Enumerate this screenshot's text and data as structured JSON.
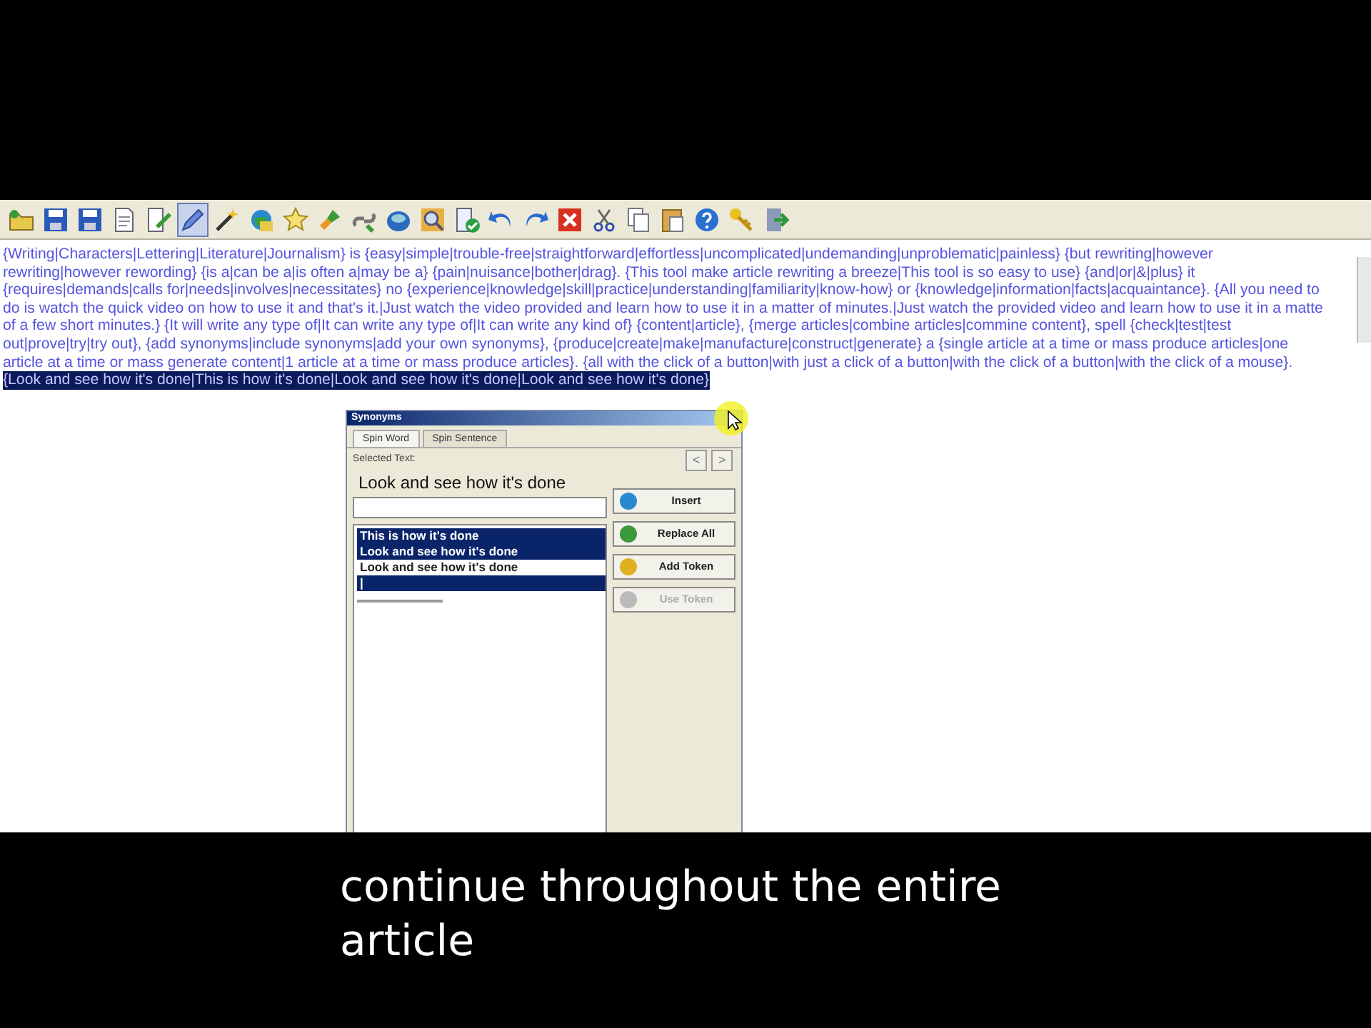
{
  "toolbar": [
    {
      "selected": false
    },
    {
      "selected": false
    },
    {
      "selected": false
    },
    {
      "selected": false
    },
    {
      "selected": false
    },
    {
      "selected": true
    },
    {
      "selected": false
    },
    {
      "selected": false
    },
    {
      "selected": false
    },
    {
      "selected": false
    },
    {
      "selected": false
    },
    {
      "selected": false
    },
    {
      "selected": false
    },
    {
      "selected": false
    },
    {
      "selected": false
    },
    {
      "selected": false
    },
    {
      "selected": false
    },
    {
      "selected": false
    },
    {
      "selected": false
    },
    {
      "selected": false
    },
    {
      "selected": false
    },
    {
      "selected": false
    },
    {
      "selected": false
    }
  ],
  "editor": {
    "lines": [
      {
        "text": "{Writing|Characters|Lettering|Literature|Journalism} is {easy|simple|trouble-free|straightforward|effortless|uncomplicated|undemanding|unproblematic|painless} {but rewriting|however",
        "selected": false
      },
      {
        "text": "rewriting|however rewording} {is a|can be a|is often a|may be a} {pain|nuisance|bother|drag}. {This tool make article rewriting a breeze|This tool is so easy to use} {and|or|&|plus} it",
        "selected": false
      },
      {
        "text": "{requires|demands|calls for|needs|involves|necessitates} no {experience|knowledge|skill|practice|understanding|familiarity|know-how} or {knowledge|information|facts|acquaintance}. {All you need to",
        "selected": false
      },
      {
        "text": "do is watch the quick video on how to use it and that's it.|Just watch the video provided and learn how to use it in a matter of minutes.|Just watch the provided video and learn how to use it in a matte",
        "selected": false
      },
      {
        "text": "of a few short minutes.} {It will write any type of|It can write any type of|It can write any kind of} {content|article}, {merge articles|combine articles|commine content}, spell {check|test|test",
        "selected": false
      },
      {
        "text": "out|prove|try|try out}, {add synonyms|include synonyms|add your own synonyms}, {produce|create|make|manufacture|construct|generate} a {single article at a time or mass produce articles|one",
        "selected": false
      },
      {
        "text": "article at a time or mass generate content|1 article at a time or mass produce articles}. {all with the click of a button|with just a click of a button|with the click of a button|with the click of a mouse}.",
        "selected": false
      },
      {
        "text": "{Look and see how it's done|This is how it's done|Look and see how it's done|Look and see how it's done}",
        "selected": true
      }
    ]
  },
  "dialog": {
    "title": "Synonyms",
    "tabs": [
      {
        "label": "Spin Word",
        "selected": true
      },
      {
        "label": "Spin Sentence",
        "selected": false
      }
    ],
    "selected_text_label": "Selected Text:",
    "nav_buttons": [
      "<",
      ">"
    ],
    "selected_text": "Look and see how it's done",
    "synonyms": [
      {
        "text": "This is how it's done",
        "selected": true
      },
      {
        "text": "Look and see how it's done",
        "selected": true
      },
      {
        "text": "Look and see how it's done",
        "selected": false
      },
      {
        "text": "|",
        "selected": true
      }
    ],
    "buttons": [
      {
        "label": "Insert",
        "disabled": false
      },
      {
        "label": "Replace All",
        "disabled": false
      },
      {
        "label": "Add Token",
        "disabled": false
      },
      {
        "label": "Use Token",
        "disabled": true
      }
    ]
  },
  "caption": [
    "continue throughout the entire",
    "article"
  ]
}
